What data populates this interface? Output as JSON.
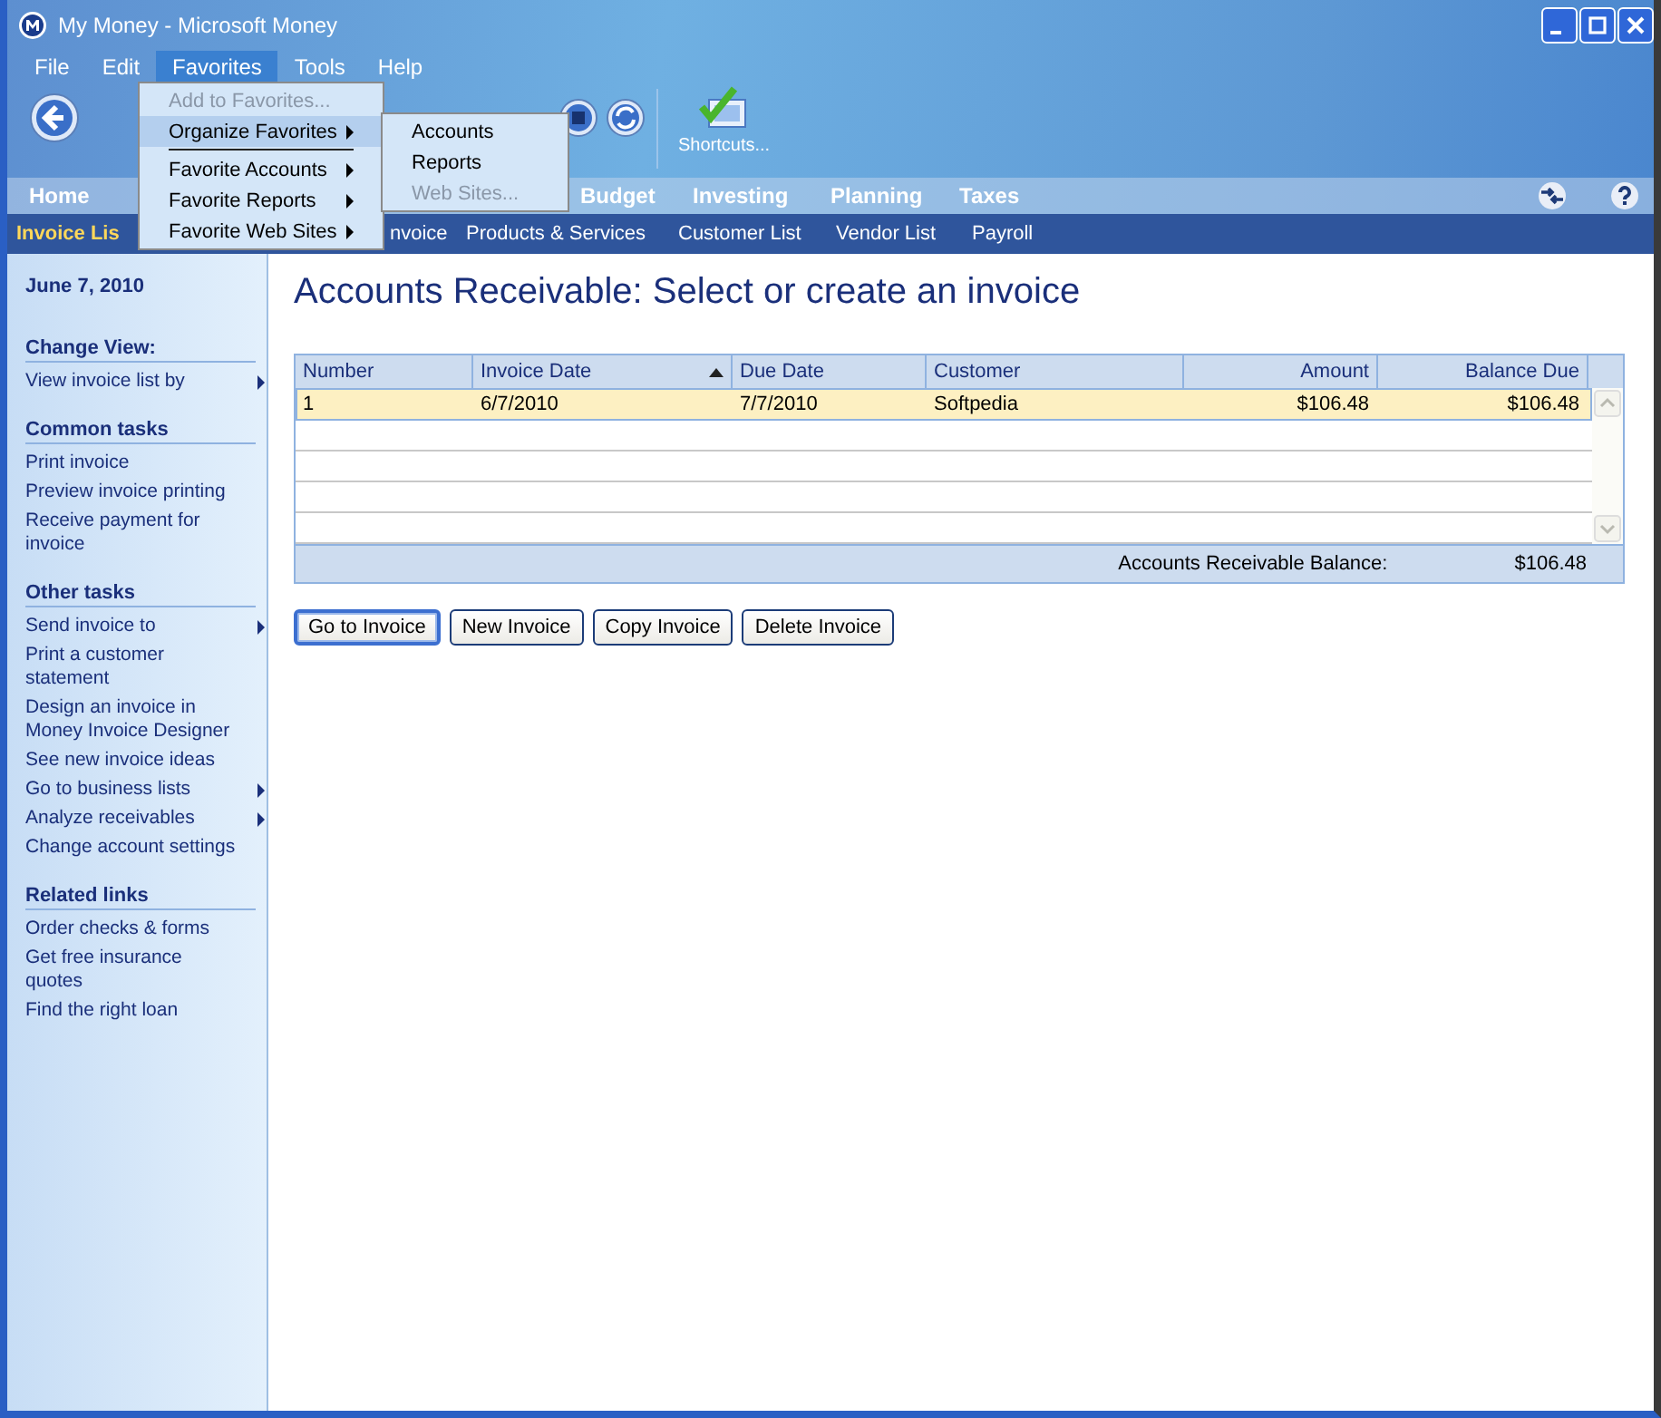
{
  "window": {
    "title": "My Money - Microsoft Money"
  },
  "menu_bar": [
    {
      "label": "File",
      "selected": false
    },
    {
      "label": "Edit",
      "selected": false
    },
    {
      "label": "Favorites",
      "selected": true
    },
    {
      "label": "Tools",
      "selected": false
    },
    {
      "label": "Help",
      "selected": false
    }
  ],
  "favorites_menu": [
    {
      "kind": "item",
      "label": "Add to Favorites...",
      "disabled": true,
      "submenu": false,
      "selected": false
    },
    {
      "kind": "item",
      "label": "Organize Favorites",
      "disabled": false,
      "submenu": true,
      "selected": true
    },
    {
      "kind": "separator"
    },
    {
      "kind": "item",
      "label": "Favorite Accounts",
      "disabled": false,
      "submenu": true,
      "selected": false
    },
    {
      "kind": "item",
      "label": "Favorite Reports",
      "disabled": false,
      "submenu": true,
      "selected": false
    },
    {
      "kind": "item",
      "label": "Favorite Web Sites",
      "disabled": false,
      "submenu": true,
      "selected": false
    }
  ],
  "organize_submenu": [
    {
      "label": "Accounts",
      "disabled": false
    },
    {
      "label": "Reports",
      "disabled": false
    },
    {
      "label": "Web Sites...",
      "disabled": true
    }
  ],
  "toolbar": {
    "shortcuts_label": "Shortcuts..."
  },
  "nav_tabs": [
    {
      "label": "Home"
    },
    {
      "label": "Budget"
    },
    {
      "label": "Investing"
    },
    {
      "label": "Planning"
    },
    {
      "label": "Taxes"
    }
  ],
  "sub_nav": [
    {
      "label": "Invoice Lis",
      "selected": true
    },
    {
      "label": "nvoice",
      "selected": false
    },
    {
      "label": "Products & Services",
      "selected": false
    },
    {
      "label": "Customer List",
      "selected": false
    },
    {
      "label": "Vendor List",
      "selected": false
    },
    {
      "label": "Payroll",
      "selected": false
    }
  ],
  "sidebar": {
    "date": "June 7, 2010",
    "sections": [
      {
        "heading": "Change View:",
        "links": [
          {
            "label": "View invoice list by",
            "submenu": true
          }
        ]
      },
      {
        "heading": "Common tasks",
        "links": [
          {
            "label": "Print invoice",
            "submenu": false
          },
          {
            "label": "Preview invoice printing",
            "submenu": false
          },
          {
            "label": "Receive payment for invoice",
            "submenu": false
          }
        ]
      },
      {
        "heading": "Other tasks",
        "links": [
          {
            "label": "Send invoice to",
            "submenu": true
          },
          {
            "label": "Print a customer statement",
            "submenu": false
          },
          {
            "label": "Design an invoice in Money Invoice Designer",
            "submenu": false
          },
          {
            "label": "See new invoice ideas",
            "submenu": false
          },
          {
            "label": "Go to business lists",
            "submenu": true
          },
          {
            "label": "Analyze receivables",
            "submenu": true
          },
          {
            "label": "Change account settings",
            "submenu": false
          }
        ]
      },
      {
        "heading": "Related links",
        "links": [
          {
            "label": "Order checks & forms",
            "submenu": false
          },
          {
            "label": "Get free insurance quotes",
            "submenu": false
          },
          {
            "label": "Find the right loan",
            "submenu": false
          }
        ]
      }
    ]
  },
  "page_title": "Accounts Receivable: Select or create an invoice",
  "table": {
    "columns": [
      {
        "label": "Number",
        "sorted": false
      },
      {
        "label": "Invoice Date",
        "sorted": true
      },
      {
        "label": "Due Date",
        "sorted": false
      },
      {
        "label": "Customer",
        "sorted": false
      },
      {
        "label": "Amount",
        "sorted": false
      },
      {
        "label": "Balance Due",
        "sorted": false
      }
    ],
    "rows": [
      {
        "cells": [
          "1",
          "6/7/2010",
          "7/7/2010",
          "Softpedia",
          "$106.48",
          "$106.48"
        ],
        "selected": true
      }
    ],
    "footer_label": "Accounts Receivable Balance:",
    "footer_value": "$106.48"
  },
  "buttons": [
    {
      "label": "Go to Invoice",
      "default": true
    },
    {
      "label": "New Invoice",
      "default": false
    },
    {
      "label": "Copy Invoice",
      "default": false
    },
    {
      "label": "Delete Invoice",
      "default": false
    }
  ]
}
